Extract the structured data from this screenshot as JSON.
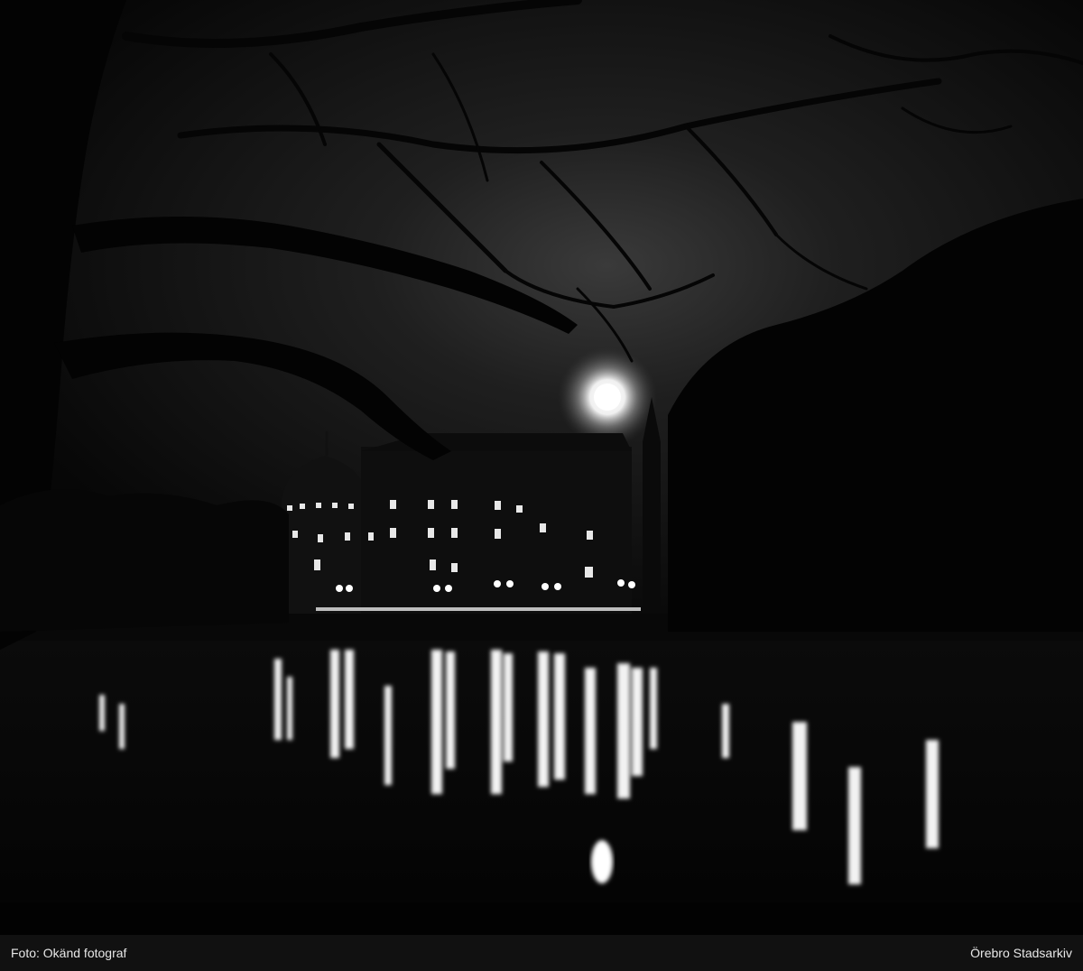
{
  "caption": {
    "credit": "Foto: Okänd fotograf",
    "archive": "Örebro Stadsarkiv"
  }
}
